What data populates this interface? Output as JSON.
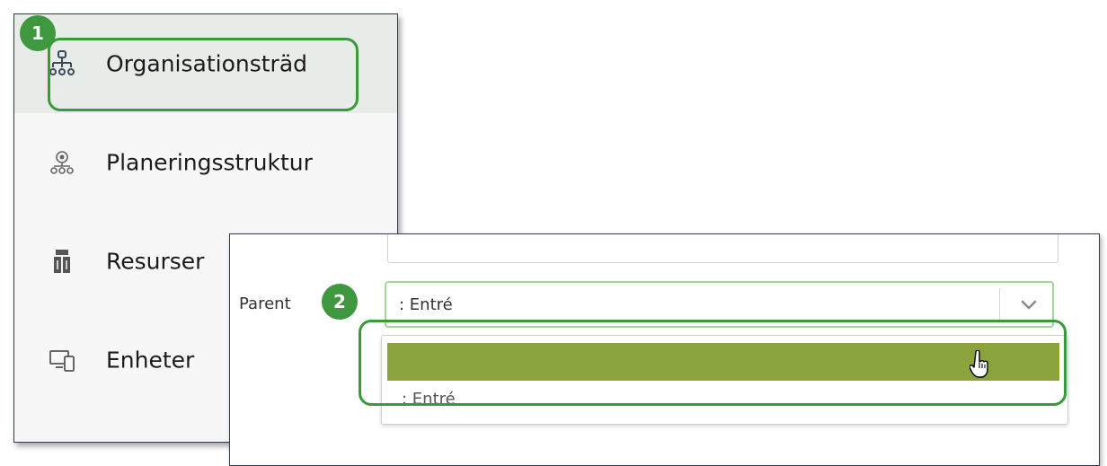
{
  "sidebar": {
    "items": [
      {
        "label": "Organisationsträd",
        "icon": "org-tree-icon",
        "active": true
      },
      {
        "label": "Planeringsstruktur",
        "icon": "planning-structure-icon",
        "active": false
      },
      {
        "label": "Resurser",
        "icon": "resources-icon",
        "active": false
      },
      {
        "label": "Enheter",
        "icon": "devices-icon",
        "active": false
      }
    ]
  },
  "form": {
    "parent_label": "Parent",
    "parent_value": ": Entré",
    "dropdown_options": [
      "",
      ": Entré"
    ]
  },
  "annotations": {
    "step1": "1",
    "step2": "2"
  },
  "colors": {
    "accent_green": "#3f9740",
    "highlight": "#8aa33d",
    "active_bg": "#e7ece8"
  }
}
